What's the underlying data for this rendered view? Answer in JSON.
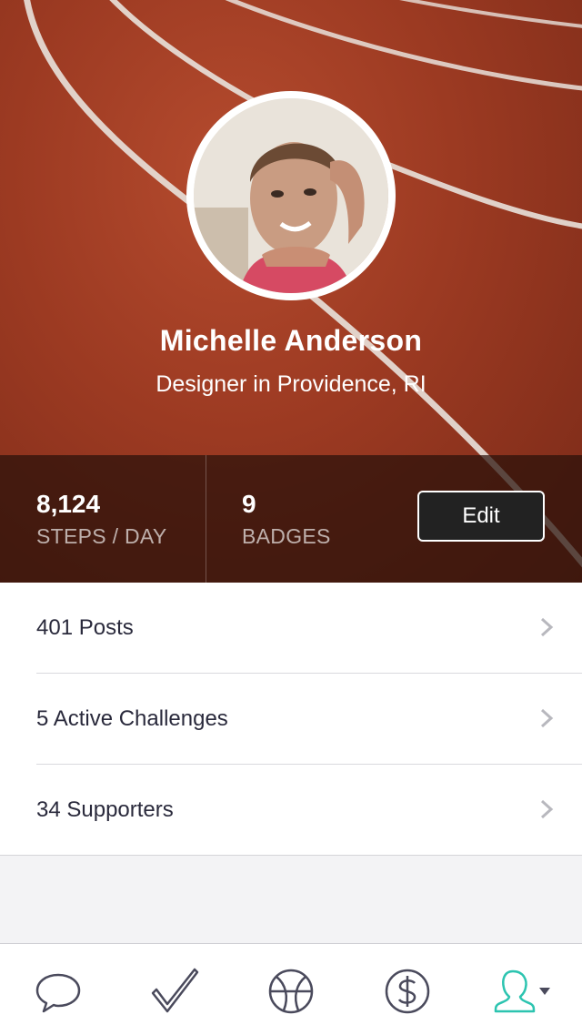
{
  "profile": {
    "name": "Michelle Anderson",
    "subtitle": "Designer in Providence, RI"
  },
  "stats": [
    {
      "value": "8,124",
      "label": "STEPS / DAY"
    },
    {
      "value": "9",
      "label": "BADGES"
    }
  ],
  "edit_label": "Edit",
  "list": [
    {
      "label": "401 Posts"
    },
    {
      "label": "5 Active Challenges"
    },
    {
      "label": "34 Supporters"
    }
  ],
  "tabs": [
    {
      "icon": "chat-bubble-icon",
      "active": false
    },
    {
      "icon": "checkmark-icon",
      "active": false
    },
    {
      "icon": "basketball-icon",
      "active": false
    },
    {
      "icon": "dollar-icon",
      "active": false
    },
    {
      "icon": "profile-icon",
      "active": true
    }
  ],
  "colors": {
    "track": "#9c3a22",
    "stats_overlay": "#28100a",
    "text_dark": "#2a2a3c",
    "tab_icon": "#4a4a5c",
    "tab_active": "#2cc4b0"
  }
}
